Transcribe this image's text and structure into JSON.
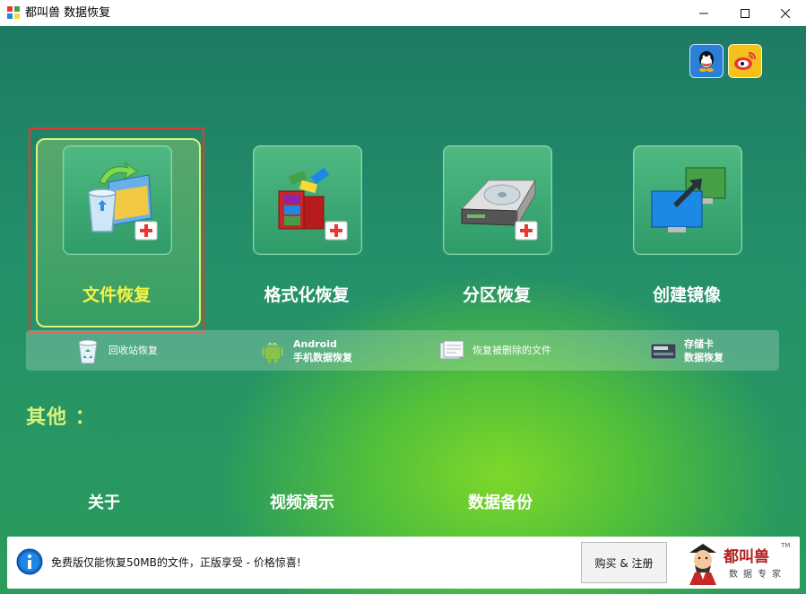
{
  "window": {
    "title": "都叫兽 数据恢复"
  },
  "features": [
    {
      "label": "文件恢复",
      "icon": "file-recovery-icon"
    },
    {
      "label": "格式化恢复",
      "icon": "format-recovery-icon"
    },
    {
      "label": "分区恢复",
      "icon": "partition-recovery-icon"
    },
    {
      "label": "创建镜像",
      "icon": "create-image-icon"
    }
  ],
  "sub_features": [
    {
      "label": "回收站恢复",
      "label2": "",
      "icon": "recycle-bin-icon"
    },
    {
      "label": "Android",
      "label2": "手机数据恢复",
      "icon": "android-icon"
    },
    {
      "label": "恢复被删除的文件",
      "label2": "",
      "icon": "deleted-file-icon"
    },
    {
      "label": "存储卡",
      "label2": "数据恢复",
      "icon": "memory-card-icon"
    }
  ],
  "others": {
    "title": "其他 ：",
    "links": [
      "关于",
      "视频演示",
      "数据备份"
    ]
  },
  "footer": {
    "notice": "免费版仅能恢复50MB的文件，正版享受 - 价格惊喜!",
    "buy_label": "购买 & 注册",
    "brand_name": "都叫兽",
    "brand_sub": "数据专家",
    "brand_tm": "TM"
  },
  "colors": {
    "selected_label": "#f3f44a",
    "others_title": "#d7f27a",
    "highlight_box": "#e53935"
  }
}
